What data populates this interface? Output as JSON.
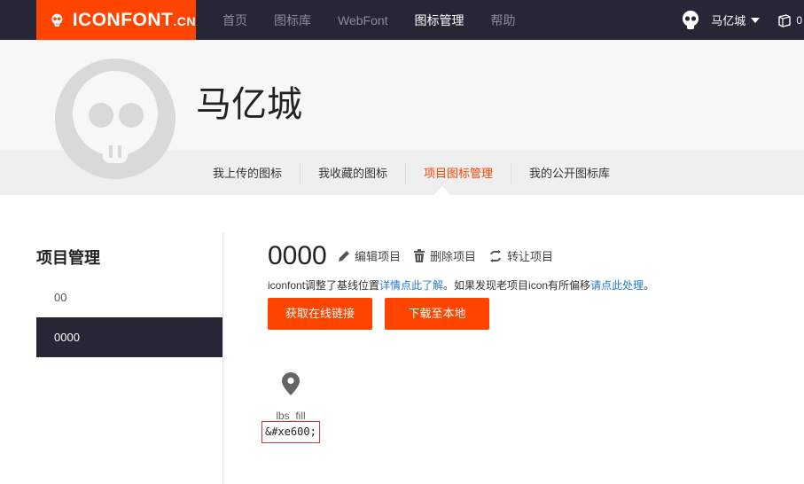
{
  "brand": {
    "name": "ICONFONT",
    "suffix": ".CN",
    "color": "#ff4400"
  },
  "nav": {
    "items": [
      {
        "label": "首页"
      },
      {
        "label": "图标库"
      },
      {
        "label": "WebFont"
      },
      {
        "label": "图标管理"
      },
      {
        "label": "帮助"
      }
    ],
    "active_index": 3
  },
  "user": {
    "name": "马亿城",
    "cart_count": "0"
  },
  "profile": {
    "name": "马亿城",
    "tabs": [
      {
        "label": "我上传的图标"
      },
      {
        "label": "我收藏的图标"
      },
      {
        "label": "项目图标管理"
      },
      {
        "label": "我的公开图标库"
      }
    ],
    "active_tab": 2
  },
  "sidebar": {
    "title": "项目管理",
    "items": [
      {
        "label": "00"
      },
      {
        "label": "0000"
      }
    ],
    "active_index": 1
  },
  "project": {
    "title": "0000",
    "actions": [
      {
        "label": "编辑项目",
        "icon": "pencil-icon"
      },
      {
        "label": "删除项目",
        "icon": "trash-icon"
      },
      {
        "label": "转让项目",
        "icon": "transfer-icon"
      }
    ],
    "notice": {
      "prefix": "iconfont调整了基线位置",
      "link1": "详情点此了解",
      "middle": "。如果发现老项目icon有所偏移",
      "link2": "请点此处理",
      "suffix": "。"
    },
    "buttons": {
      "online_link": "获取在线链接",
      "download": "下载至本地"
    },
    "icons": [
      {
        "name": "lbs_fill",
        "code": "&#xe600;",
        "icon": "location-pin-icon"
      }
    ]
  },
  "colors": {
    "accent": "#ff4400",
    "dark": "#272636",
    "link": "#1e7ad6"
  }
}
